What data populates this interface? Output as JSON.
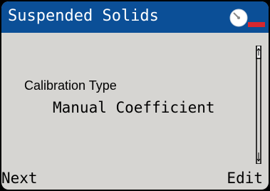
{
  "header": {
    "title": "Suspended Solids",
    "status_icon": "timer-warning-icon",
    "background_color": "#0b4f97"
  },
  "main": {
    "field_label": "Calibration Type",
    "field_value": "Manual Coefficient"
  },
  "softkeys": {
    "left_label": "Next",
    "right_label": "Edit"
  },
  "colors": {
    "screen_background": "#d6d5d2",
    "text": "#000000",
    "indicator_red": "#d7282f"
  }
}
